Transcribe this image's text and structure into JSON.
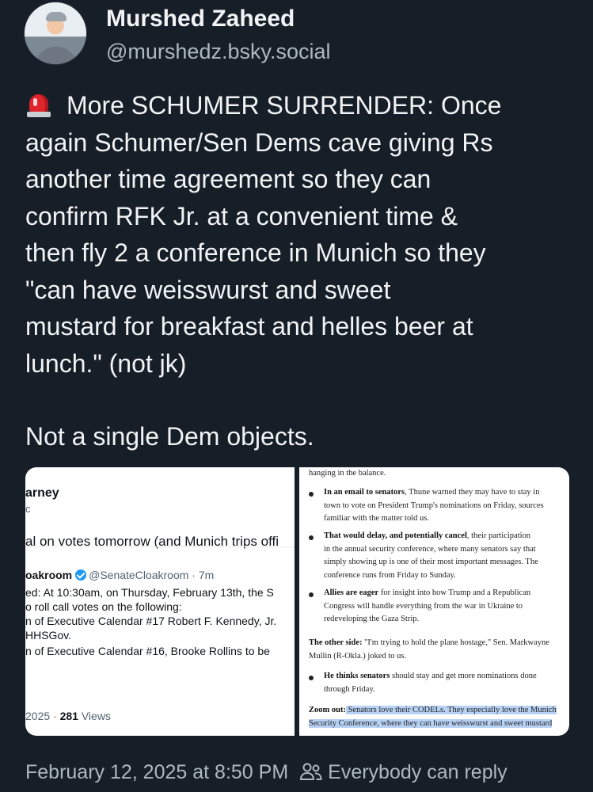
{
  "author": {
    "name": "Murshed Zaheed",
    "handle": "@murshedz.bsky.social"
  },
  "post": {
    "lines": [
      "More SCHUMER SURRENDER: Once",
      "again Schumer/Sen Dems cave giving Rs",
      "another time agreement so they can",
      "confirm RFK Jr. at a convenient time &",
      "then fly 2 a conference in Munich so they",
      "\"can have weisswurst and sweet",
      "mustard for breakfast and helles beer at",
      "lunch.\" (not jk)"
    ],
    "closing": "Not a single Dem objects.",
    "icon": "police-siren-icon"
  },
  "embedded_tweet": {
    "name_fragment": "arney",
    "handle_fragment": "c",
    "text": "al on votes tomorrow (and Munich trips offi",
    "quoted": {
      "name_fragment": "oakroom",
      "handle": "@SenateCloakroom · 7m",
      "lines": [
        "ed: At 10:30am, on Thursday, February 13th, the S",
        "o roll call votes on the following:",
        "n of Executive Calendar #17 Robert F. Kennedy, Jr.",
        "HHSGov.",
        "n of Executive Calendar #16, Brooke Rollins to be"
      ]
    },
    "date_fragment": "2025 · ",
    "views_count": "281",
    "views_label": " Views"
  },
  "article": {
    "top": "hanging in the balance.",
    "bullets": [
      {
        "bold": "In an email to senators",
        "rest": [
          ", Thune warned they may have to stay in",
          "town to vote on President Trump's nominations on Friday, sources",
          "familiar with the matter told us."
        ]
      },
      {
        "bold": "That would delay, and potentially cancel",
        "rest": [
          ", their participation",
          "in the annual security conference, where many senators say that",
          "simply showing up is one of their most important messages. The",
          "conference runs from Friday to Sunday."
        ]
      },
      {
        "bold": "Allies are eager",
        "rest": [
          " for insight into how Trump and a Republican",
          "Congress will handle everything from the war in Ukraine to",
          "redeveloping the Gaza Strip."
        ]
      }
    ],
    "other_side_bold": "The other side:",
    "other_side_text": [
      " \"I'm trying to hold the plane hostage,\" Sen. Markwayne",
      "Mullin (R-Okla.) joked to us."
    ],
    "bullet4": {
      "bold": "He thinks senators",
      "rest": [
        " should stay and get more nominations done",
        "through Friday."
      ]
    },
    "zoom_bold": "Zoom out:",
    "zoom_text": [
      " Senators love their CODELs. They especially love the Munich",
      "Security Conference, where they can have weisswurst and sweet mustard"
    ]
  },
  "footer": {
    "timestamp": "February 12, 2025 at 8:50 PM",
    "reply_setting": "Everybody can reply",
    "icon": "people-icon"
  },
  "colors": {
    "background": "#161e27",
    "text": "#f1f3f5",
    "muted": "#aeb8c2",
    "highlight": "#b8d2f5"
  }
}
